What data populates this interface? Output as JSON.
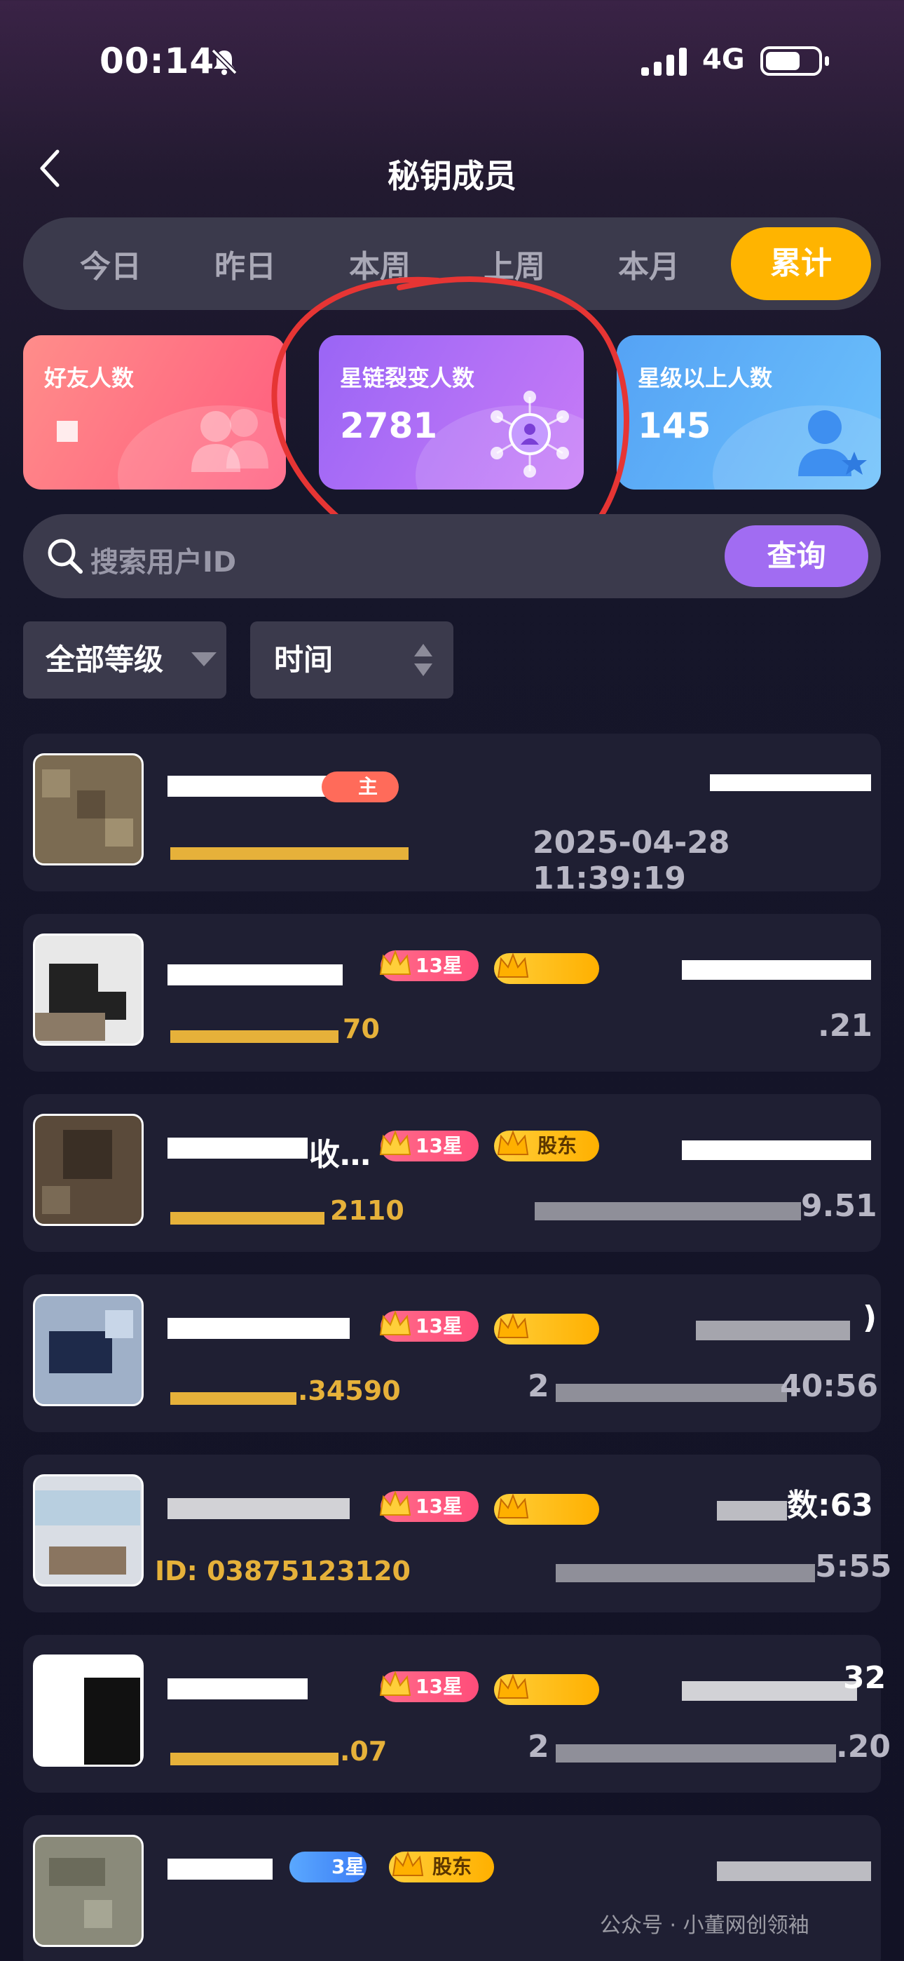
{
  "status": {
    "time": "00:14",
    "network": "4G"
  },
  "header": {
    "title": "秘钥成员"
  },
  "tabs": [
    "今日",
    "昨日",
    "本周",
    "上周",
    "本月",
    "累计"
  ],
  "active_tab": "累计",
  "stats": [
    {
      "label": "好友人数",
      "value": ""
    },
    {
      "label": "星链裂变人数",
      "value": "2781"
    },
    {
      "label": "星级以上人数",
      "value": "145"
    }
  ],
  "search": {
    "placeholder": "搜索用户ID",
    "button": "查询"
  },
  "filters": {
    "level": "全部等级",
    "time": "时间"
  },
  "rows": [
    {
      "tag": "主",
      "id_suffix": "",
      "timestamp": "2025-04-28 11:39:19",
      "right_top": ""
    },
    {
      "star": "13星",
      "id_suffix": "70",
      "timestamp": ".21",
      "right_top": ""
    },
    {
      "name_frag": "收…",
      "star": "13星",
      "gold": "股东",
      "id_suffix": "2110",
      "timestamp": "9.51",
      "right_top": ""
    },
    {
      "star": "13星",
      "id_suffix": ".34590",
      "timestamp": "40:56",
      "ts_prefix": "2",
      "right_top": ")"
    },
    {
      "star": "13星",
      "id_suffix": "ID: 03875123120",
      "timestamp": "5:55",
      "right_top": "数:63"
    },
    {
      "star": "13星",
      "id_suffix": ".07",
      "timestamp": ".20",
      "ts_prefix": "2",
      "right_top": "32"
    },
    {
      "star": "3星",
      "gold": "股东",
      "id_suffix": "",
      "timestamp": "",
      "right_top": ""
    }
  ],
  "watermark": "公众号 · 小董网创领袖"
}
